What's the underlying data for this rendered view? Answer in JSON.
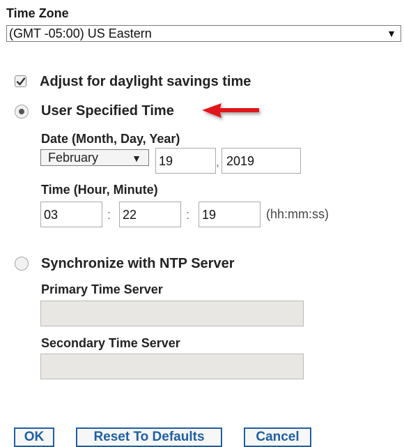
{
  "time_zone": {
    "label": "Time Zone",
    "selected": "(GMT -05:00) US Eastern",
    "arrow": "▼"
  },
  "dst": {
    "label": "Adjust for daylight savings time",
    "checked": true
  },
  "user_time": {
    "label": "User Specified Time",
    "selected": true,
    "date_label": "Date (Month, Day, Year)",
    "month": "February",
    "month_arrow": "▼",
    "day": "19",
    "year": "2019",
    "date_sep": ",",
    "time_label": "Time (Hour, Minute)",
    "hour": "03",
    "minute": "22",
    "second": "19",
    "time_sep": ":",
    "format_hint": "(hh:mm:ss)"
  },
  "ntp": {
    "label": "Synchronize with NTP Server",
    "selected": false,
    "primary_label": "Primary Time Server",
    "primary_value": "",
    "secondary_label": "Secondary Time Server",
    "secondary_value": ""
  },
  "buttons": {
    "ok": "OK",
    "reset": "Reset To Defaults",
    "cancel": "Cancel"
  },
  "colors": {
    "button_border": "#1f5fa0",
    "annotation_arrow": "#e0171b"
  },
  "icons": {
    "annotation": "red-arrow-icon"
  }
}
